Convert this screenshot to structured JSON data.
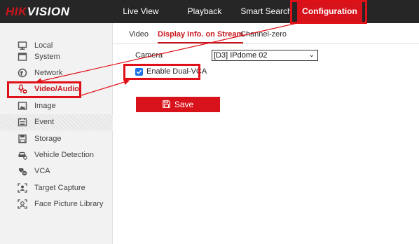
{
  "header": {
    "logo_hik": "HIK",
    "logo_vision": "VISION",
    "nav": {
      "live_view": "Live View",
      "playback": "Playback",
      "smart_search": "Smart Search",
      "configuration": "Configuration"
    }
  },
  "sidebar": {
    "items": [
      {
        "label": "Local",
        "icon": "monitor-icon"
      },
      {
        "label": "System",
        "icon": "window-icon"
      },
      {
        "label": "Network",
        "icon": "globe-icon"
      },
      {
        "label": "Video/Audio",
        "icon": "video-audio-icon",
        "active": true
      },
      {
        "label": "Image",
        "icon": "image-icon"
      },
      {
        "label": "Event",
        "icon": "calendar-icon"
      },
      {
        "label": "Storage",
        "icon": "storage-icon"
      },
      {
        "label": "Vehicle Detection",
        "icon": "vehicle-icon"
      },
      {
        "label": "VCA",
        "icon": "vca-icon"
      },
      {
        "label": "Target Capture",
        "icon": "target-capture-icon"
      },
      {
        "label": "Face Picture Library",
        "icon": "face-library-icon"
      }
    ]
  },
  "tabs": {
    "video": "Video",
    "display_info": "Display Info. on Stream",
    "channel_zero": "Channel-zero"
  },
  "form": {
    "camera_label": "Camera",
    "camera_value": "[D3] IPdome 02",
    "dual_vca_label": "Enable Dual-VCA",
    "dual_vca_checked": true,
    "save_label": "Save"
  },
  "colors": {
    "brand_red": "#d8121b",
    "topbar": "#262626",
    "annotation": "#e01018",
    "checkbox": "#1a73e8"
  }
}
